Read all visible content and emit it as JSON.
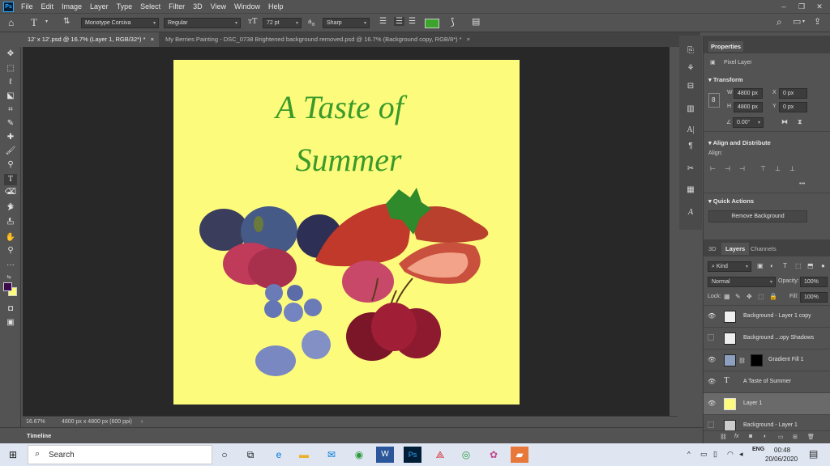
{
  "menu": {
    "items": [
      "File",
      "Edit",
      "Image",
      "Layer",
      "Type",
      "Select",
      "Filter",
      "3D",
      "View",
      "Window",
      "Help"
    ],
    "logo": "Ps"
  },
  "options": {
    "font_family": "Monotype Corsiva",
    "font_style": "Regular",
    "font_size": "72 pt",
    "aa_label": "a",
    "antialias": "Sharp",
    "color_swatch": "#3aa52a"
  },
  "tabs": [
    {
      "label": "12' x 12'.psd @ 16.7% (Layer 1, RGB/32*) *",
      "close": "×"
    },
    {
      "label": "My Berries Painting - DSC_0738 Brightened background removed.psd @ 16.7% (Background copy, RGB/8*) *",
      "close": "×"
    }
  ],
  "document": {
    "title_line1": "A Taste of",
    "title_line2": "Summer",
    "background": "#fdfb7c",
    "text_color": "#3a9a2a"
  },
  "status": {
    "zoom": "16.67%",
    "dims": "4800 px x 4800 px (600 ppi)",
    "arrow": "›"
  },
  "timeline": {
    "label": "Timeline"
  },
  "properties": {
    "tab": "Properties",
    "kind": "Pixel Layer",
    "transform": "Transform",
    "w_label": "W",
    "w": "4800 px",
    "h_label": "H",
    "h": "4800 px",
    "x_label": "X",
    "x": "0 px",
    "y_label": "Y",
    "y": "0 px",
    "angle": "0.00°",
    "align_heading": "Align and Distribute",
    "align_label": "Align:",
    "more": "•••",
    "quick_actions": "Quick Actions",
    "remove_bg": "Remove Background"
  },
  "layers_panel": {
    "tabs": [
      "3D",
      "Layers",
      "Channels"
    ],
    "filter": "Kind",
    "blend": "Normal",
    "opacity_label": "Opacity:",
    "opacity": "100%",
    "lock_label": "Lock:",
    "fill_label": "Fill:",
    "fill": "100%",
    "layers": [
      {
        "name": "Background - Layer 1 copy",
        "visible": true
      },
      {
        "name": "Background ...opy Shadows",
        "visible": false
      },
      {
        "name": "Gradient Fill 1",
        "visible": true
      },
      {
        "name": "A Taste of  Summer",
        "visible": true
      },
      {
        "name": "Layer 1",
        "visible": true,
        "selected": true
      },
      {
        "name": "Background - Layer 1",
        "visible": false
      }
    ]
  },
  "taskbar": {
    "search": "Search",
    "time": "00:48",
    "date": "20/06/2020",
    "lang": "ENG"
  },
  "colors": {
    "foreground": "#3b0a4d",
    "background": "#fdfb7c"
  }
}
